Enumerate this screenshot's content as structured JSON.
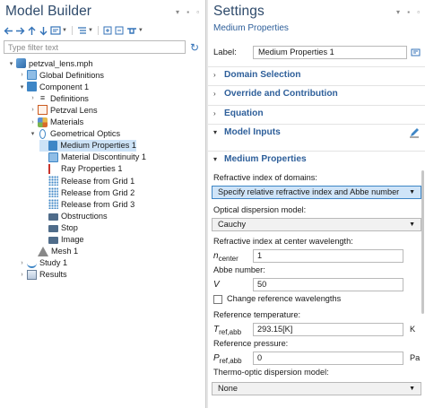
{
  "left_panel": {
    "title": "Model Builder",
    "window_controls": "▾ ▪ ▫",
    "filter_placeholder": "Type filter text",
    "tree": [
      {
        "label": "petzval_lens.mph",
        "toggle": "▾",
        "icon": "file-icon",
        "depth": 0
      },
      {
        "label": "Global Definitions",
        "toggle": "›",
        "icon": "globe-icon",
        "depth": 1
      },
      {
        "label": "Component 1",
        "toggle": "▾",
        "icon": "component-icon",
        "depth": 1
      },
      {
        "label": "Definitions",
        "toggle": "›",
        "icon": "definitions-icon",
        "depth": 2
      },
      {
        "label": "Petzval Lens",
        "toggle": "›",
        "icon": "geometry-icon",
        "depth": 2
      },
      {
        "label": "Materials",
        "toggle": "›",
        "icon": "materials-icon",
        "depth": 2
      },
      {
        "label": "Geometrical Optics",
        "toggle": "▾",
        "icon": "geometrical-optics-icon",
        "depth": 2
      },
      {
        "label": "Medium Properties 1",
        "toggle": "",
        "icon": "medium-properties-icon",
        "depth": 3,
        "selected": true
      },
      {
        "label": "Material Discontinuity 1",
        "toggle": "",
        "icon": "material-discontinuity-icon",
        "depth": 3
      },
      {
        "label": "Ray Properties 1",
        "toggle": "",
        "icon": "ray-properties-icon",
        "depth": 3
      },
      {
        "label": "Release from Grid 1",
        "toggle": "",
        "icon": "release-grid-icon",
        "depth": 3
      },
      {
        "label": "Release from Grid 2",
        "toggle": "",
        "icon": "release-grid-icon",
        "depth": 3
      },
      {
        "label": "Release from Grid 3",
        "toggle": "",
        "icon": "release-grid-icon",
        "depth": 3
      },
      {
        "label": "Obstructions",
        "toggle": "",
        "icon": "obstruction-icon",
        "depth": 3
      },
      {
        "label": "Stop",
        "toggle": "",
        "icon": "stop-icon",
        "depth": 3
      },
      {
        "label": "Image",
        "toggle": "",
        "icon": "image-icon",
        "depth": 3
      },
      {
        "label": "Mesh 1",
        "toggle": "",
        "icon": "mesh-icon",
        "depth": 2
      },
      {
        "label": "Study 1",
        "toggle": "›",
        "icon": "study-icon",
        "depth": 1
      },
      {
        "label": "Results",
        "toggle": "›",
        "icon": "results-icon",
        "depth": 1
      }
    ]
  },
  "right_panel": {
    "title": "Settings",
    "window_controls": "▾ ▪ ▫",
    "subtitle": "Medium Properties",
    "label_caption": "Label:",
    "label_value": "Medium Properties 1",
    "sections": {
      "domain_selection": "Domain Selection",
      "override": "Override and Contribution",
      "equation": "Equation",
      "model_inputs": "Model Inputs",
      "medium_properties": "Medium Properties"
    },
    "toggles": {
      "collapsed": "›",
      "expanded": "▾"
    },
    "refractive_index_caption": "Refractive index of domains:",
    "refractive_index_value": "Specify relative refractive index and Abbe number",
    "dispersion_caption": "Optical dispersion model:",
    "dispersion_value": "Cauchy",
    "center_wavelength_caption": "Refractive index at center wavelength:",
    "n_symbol": "n",
    "n_sub": "center",
    "n_value": "1",
    "abbe_caption": "Abbe number:",
    "v_symbol": "V",
    "v_value": "50",
    "change_ref_label": "Change reference wavelengths",
    "ref_temp_caption": "Reference temperature:",
    "t_symbol": "T",
    "t_sub": "ref,abb",
    "t_value": "293.15[K]",
    "t_unit": "K",
    "ref_pressure_caption": "Reference pressure:",
    "p_symbol": "P",
    "p_sub": "ref,abb",
    "p_value": "0",
    "p_unit": "Pa",
    "thermo_caption": "Thermo-optic dispersion model:",
    "thermo_value": "None"
  }
}
